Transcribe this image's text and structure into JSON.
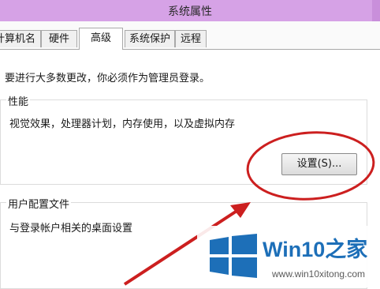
{
  "window": {
    "title": "系统属性"
  },
  "tabs": [
    {
      "label": "计算机名"
    },
    {
      "label": "硬件"
    },
    {
      "label": "高级"
    },
    {
      "label": "系统保护"
    },
    {
      "label": "远程"
    }
  ],
  "advanced": {
    "admin_notice": "要进行大多数更改，你必须作为管理员登录。",
    "performance": {
      "title": "性能",
      "description": "视觉效果，处理器计划，内存使用，以及虚拟内存",
      "settings_button": "设置(S)..."
    },
    "user_profiles": {
      "title": "用户配置文件",
      "description": "与登录帐户相关的桌面设置"
    }
  },
  "watermark": {
    "brand": "Win10之家",
    "site": "www.win10xitong.com"
  },
  "colors": {
    "titlebar": "#d6a2e6",
    "annotation": "#cc1f1f",
    "logo_blue": "#1d6fb8"
  }
}
